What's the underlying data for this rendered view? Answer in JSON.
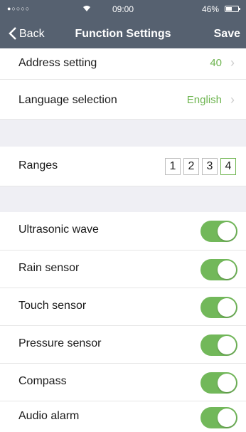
{
  "status_bar": {
    "signal": "●○○○○",
    "time": "09:00",
    "battery_pct": "46%"
  },
  "nav": {
    "back_label": "Back",
    "title": "Function Settings",
    "save_label": "Save"
  },
  "address": {
    "label": "Address setting",
    "value": "40"
  },
  "language": {
    "label": "Language selection",
    "value": "English"
  },
  "ranges": {
    "label": "Ranges",
    "options": [
      "1",
      "2",
      "3",
      "4"
    ],
    "selected": "4"
  },
  "toggles": [
    {
      "label": "Ultrasonic wave",
      "on": true
    },
    {
      "label": "Rain sensor",
      "on": true
    },
    {
      "label": "Touch sensor",
      "on": true
    },
    {
      "label": "Pressure sensor",
      "on": true
    },
    {
      "label": "Compass",
      "on": true
    },
    {
      "label": "Audio alarm",
      "on": true
    }
  ],
  "colors": {
    "nav_bg": "#566170",
    "accent": "#72b85a",
    "value_text": "#6fb551",
    "section_bg": "#efeff4"
  }
}
